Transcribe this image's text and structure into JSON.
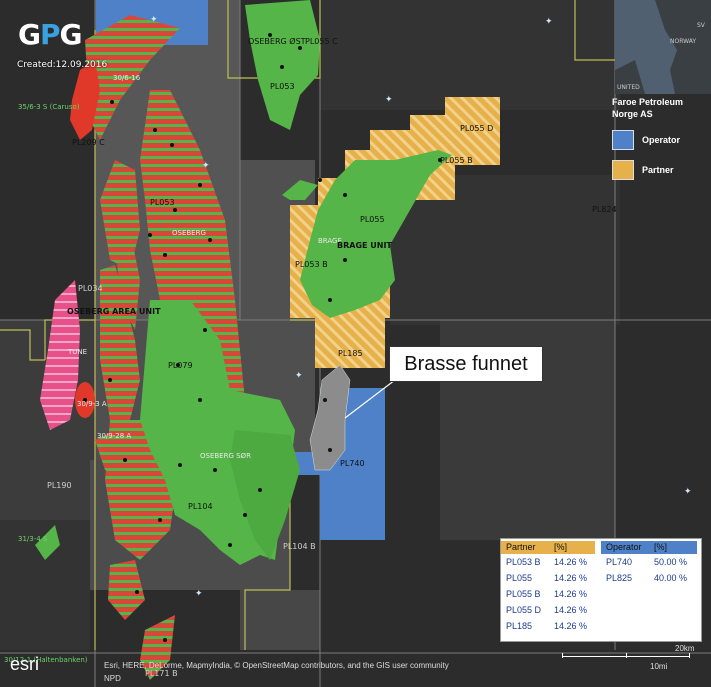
{
  "logo": {
    "text_g": "G",
    "text_p": "P",
    "text_g2": "G",
    "created": "Created:12.09.2016"
  },
  "callout": {
    "text": "Brasse funnet"
  },
  "legend": {
    "title": "Faroe Petroleum Norge AS",
    "items": [
      {
        "label": "Operator",
        "color": "#4f81c9"
      },
      {
        "label": "Partner",
        "color": "#e6b04a"
      }
    ]
  },
  "minimap": {
    "labels": [
      "SV",
      "NORWAY",
      "UNITED"
    ]
  },
  "labels": {
    "oseberg_ost": "OSEBERG ØST",
    "pl055c": "PL055 C",
    "pl053_top": "PL053",
    "pl055d": "PL055 D",
    "pl055b": "PL055 B",
    "pl209c": "PL209 C",
    "pl_35_3": "35/6-3 S (Caruso)",
    "f3016": "30/6-16",
    "pl053_mid": "PL053",
    "oseberg": "OSEBERG",
    "pl055": "PL055",
    "brage": "BRAGE",
    "brage_unit": "BRAGE UNIT",
    "pl053b": "PL053 B",
    "pl824": "PL824",
    "pl034": "PL034",
    "oseberg_area": "OSEBERG AREA UNIT",
    "tune": "TUNE",
    "pl079": "PL079",
    "pl185": "PL185",
    "pl740": "PL740",
    "f303": "30/9-3 A",
    "f30928": "30/9-28 A",
    "oseberg_sor": "OSEBERG SØR",
    "pl190": "PL190",
    "pl104": "PL104",
    "pl104b": "PL104 B",
    "f3124": "31/3-4 S",
    "pl171b": "PL171 B",
    "bottom_field": "30/12-1 (Haltenbanken)"
  },
  "partner_table": {
    "headers": [
      "Partner",
      "[%]"
    ],
    "rows": [
      [
        "PL053 B",
        "14.26 %"
      ],
      [
        "PL055",
        "14.26 %"
      ],
      [
        "PL055 B",
        "14.26 %"
      ],
      [
        "PL055 D",
        "14.26 %"
      ],
      [
        "PL185",
        "14.26 %"
      ]
    ]
  },
  "operator_table": {
    "headers": [
      "Operator",
      "[%]"
    ],
    "rows": [
      [
        "PL740",
        "50.00 %"
      ],
      [
        "PL825",
        "40.00 %"
      ]
    ]
  },
  "attribution": {
    "esri": "esri",
    "line1": "Esri, HERE, DeLorme, MapmyIndia, © OpenStreetMap contributors, and the GIS user community",
    "line2": "NPD"
  },
  "scale": {
    "km": "20km",
    "mi": "10mi"
  },
  "colors": {
    "operator": "#4f81c9",
    "partner": "#e6b04a",
    "field_green": "#55b548",
    "stripe_red": "#d9473a",
    "tune_pink": "#e8508a"
  }
}
